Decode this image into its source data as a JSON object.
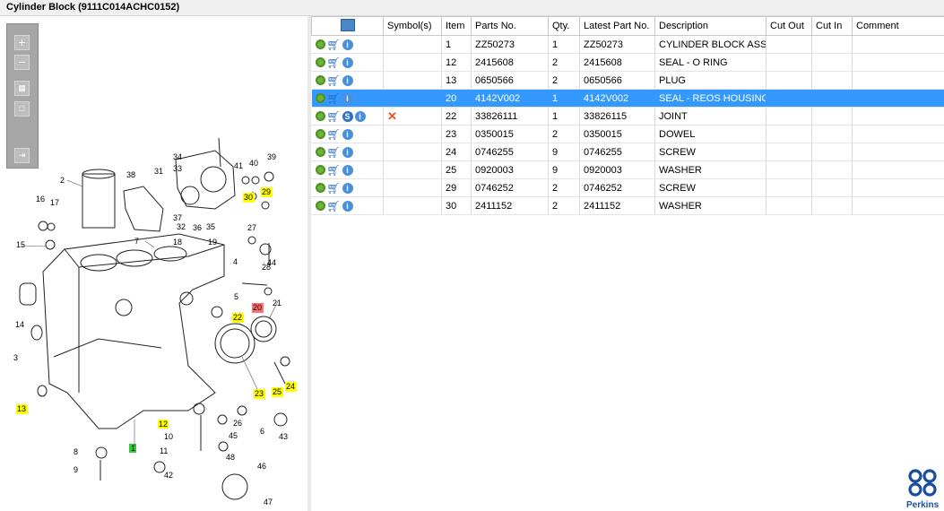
{
  "window": {
    "title": "Cylinder Block (9111C014ACHC0152)"
  },
  "toolbar": {
    "icons": [
      "zoom-in-icon",
      "zoom-out-icon",
      "fit-page-icon",
      "actual-size-icon",
      "export-icon"
    ]
  },
  "diagram": {
    "labels": [
      "1",
      "2",
      "3",
      "4",
      "5",
      "6",
      "7",
      "8",
      "9",
      "10",
      "11",
      "12",
      "13",
      "14",
      "15",
      "16",
      "17",
      "18",
      "19",
      "20",
      "21",
      "22",
      "23",
      "24",
      "25",
      "26",
      "27",
      "28",
      "29",
      "30",
      "31",
      "32",
      "33",
      "34",
      "35",
      "36",
      "37",
      "38",
      "39",
      "40",
      "41",
      "42",
      "43",
      "44",
      "45",
      "46",
      "47",
      "48"
    ],
    "highlight_colors": {
      "yellow": "#ffff00",
      "red": "#ff7070",
      "green": "#33cc33"
    }
  },
  "table": {
    "columns": [
      "",
      "Symbol(s)",
      "Item",
      "Parts No.",
      "Qty.",
      "Latest Part No.",
      "Description",
      "Cut Out",
      "Cut In",
      "Comment"
    ],
    "rows": [
      {
        "symbol": "",
        "item": "1",
        "part": "ZZ50273",
        "qty": "1",
        "latest": "ZZ50273",
        "desc": "CYLINDER BLOCK ASSEMBLY",
        "cutout": "",
        "cutin": "",
        "comment": "",
        "extra": "",
        "selected": false
      },
      {
        "symbol": "",
        "item": "12",
        "part": "2415608",
        "qty": "2",
        "latest": "2415608",
        "desc": "SEAL - O RING",
        "cutout": "",
        "cutin": "",
        "comment": "",
        "extra": "",
        "selected": false
      },
      {
        "symbol": "",
        "item": "13",
        "part": "0650566",
        "qty": "2",
        "latest": "0650566",
        "desc": "PLUG",
        "cutout": "",
        "cutin": "",
        "comment": "",
        "extra": "",
        "selected": false
      },
      {
        "symbol": "",
        "item": "20",
        "part": "4142V002",
        "qty": "1",
        "latest": "4142V002",
        "desc": "SEAL - REOS HOUSING",
        "cutout": "",
        "cutin": "",
        "comment": "",
        "extra": "",
        "selected": true
      },
      {
        "symbol": "✕",
        "item": "22",
        "part": "33826111",
        "qty": "1",
        "latest": "33826115",
        "desc": "JOINT",
        "cutout": "",
        "cutin": "",
        "comment": "",
        "extra": "S",
        "selected": false
      },
      {
        "symbol": "",
        "item": "23",
        "part": "0350015",
        "qty": "2",
        "latest": "0350015",
        "desc": "DOWEL",
        "cutout": "",
        "cutin": "",
        "comment": "",
        "extra": "",
        "selected": false
      },
      {
        "symbol": "",
        "item": "24",
        "part": "0746255",
        "qty": "9",
        "latest": "0746255",
        "desc": "SCREW",
        "cutout": "",
        "cutin": "",
        "comment": "",
        "extra": "",
        "selected": false
      },
      {
        "symbol": "",
        "item": "25",
        "part": "0920003",
        "qty": "9",
        "latest": "0920003",
        "desc": "WASHER",
        "cutout": "",
        "cutin": "",
        "comment": "",
        "extra": "",
        "selected": false
      },
      {
        "symbol": "",
        "item": "29",
        "part": "0746252",
        "qty": "2",
        "latest": "0746252",
        "desc": "SCREW",
        "cutout": "",
        "cutin": "",
        "comment": "",
        "extra": "",
        "selected": false
      },
      {
        "symbol": "",
        "item": "30",
        "part": "2411152",
        "qty": "2",
        "latest": "2411152",
        "desc": "WASHER",
        "cutout": "",
        "cutin": "",
        "comment": "",
        "extra": "",
        "selected": false
      }
    ]
  },
  "brand": {
    "name": "Perkins",
    "color": "#1a4fa0"
  },
  "colors": {
    "selection": "#3399ff"
  }
}
